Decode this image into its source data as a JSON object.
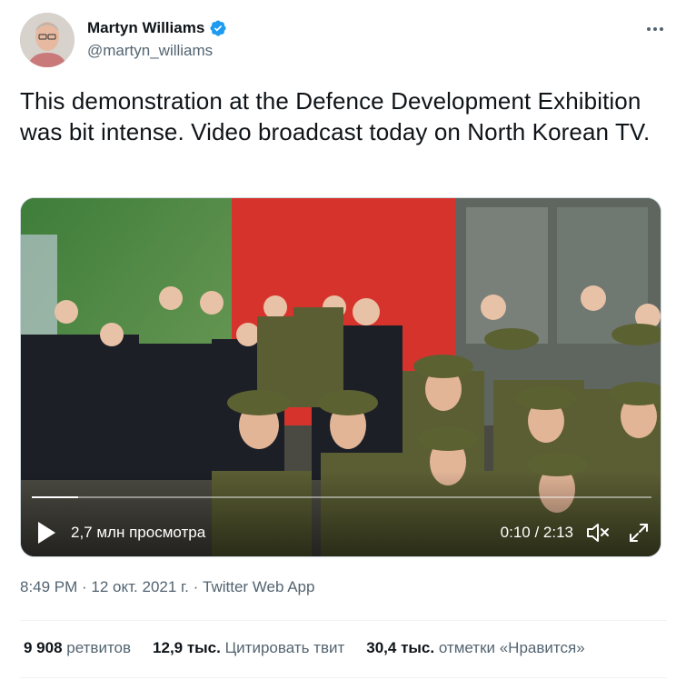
{
  "author": {
    "display_name": "Martyn Williams",
    "handle": "@martyn_williams",
    "verified": true,
    "verified_icon": "verified-badge-icon",
    "accent_color": "#1d9bf0"
  },
  "tweet": {
    "text": "This demonstration at the Defence Development Exhibition was bit intense. Video broadcast today on North Korean TV."
  },
  "video": {
    "views": "2,7 млн просмотра",
    "time": "0:10 / 2:13",
    "progress": 0.075,
    "icons": [
      "play-icon",
      "volume-muted-icon",
      "fullscreen-icon"
    ]
  },
  "meta": {
    "time": "8:49 PM",
    "date": "12 окт. 2021 г.",
    "separator": " · ",
    "source": "Twitter Web App"
  },
  "stats": {
    "retweets_count": "9 908",
    "retweets_label": "ретвитов",
    "quotes_count": "12,9 тыс.",
    "quotes_label": "Цитировать твит",
    "likes_count": "30,4 тыс.",
    "likes_label": "отметки «Нравится»"
  }
}
